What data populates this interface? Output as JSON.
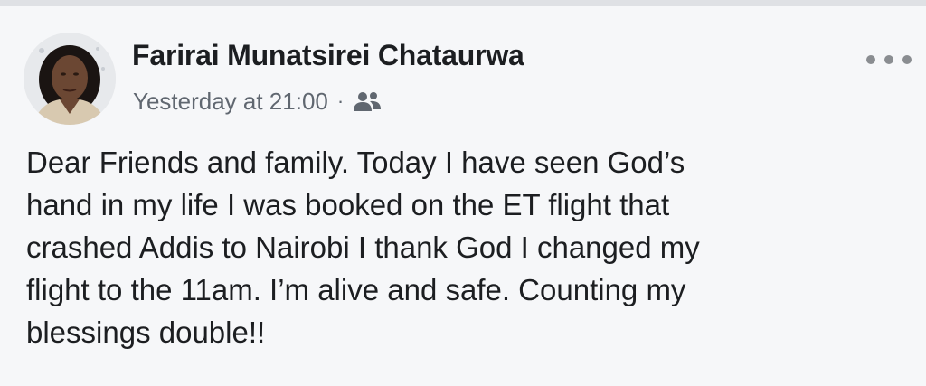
{
  "post": {
    "author": "Farirai Munatsirei Chataurwa",
    "timestamp": "Yesterday at 21:00",
    "separator": "·",
    "audience_icon": "friends-icon",
    "more_icon": "more-options-icon",
    "text_lines": [
      "Dear Friends and family. Today I have seen God’s",
      "hand in my life I was booked on the ET flight that",
      "crashed Addis to Nairobi I thank God I changed my",
      "flight to the 11am. I’m alive and safe. Counting my",
      "blessings double!!"
    ]
  },
  "colors": {
    "background": "#f6f7f9",
    "name_text": "#1c1e21",
    "meta_text": "#606770",
    "icon_gray": "#8a8d91"
  }
}
